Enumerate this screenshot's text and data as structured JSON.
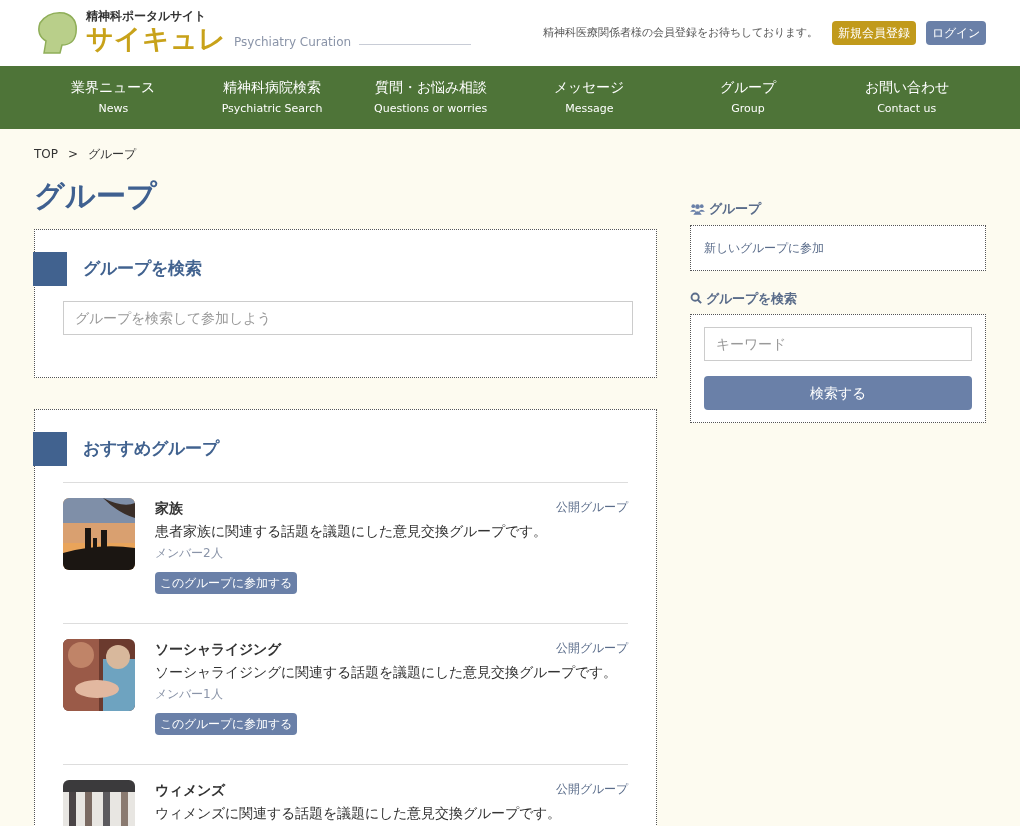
{
  "header": {
    "tagline": "精神科ポータルサイト",
    "logo": "サイキュレ",
    "subtitle": "Psychiatry Curation",
    "notice": "精神科医療関係者様の会員登録をお待ちしております。",
    "buttons": [
      {
        "kind": "register",
        "label": "新規会員登録"
      },
      {
        "kind": "login",
        "label": "ログイン"
      }
    ]
  },
  "nav": [
    {
      "label": "業界ニュース",
      "sub": "News"
    },
    {
      "label": "精神科病院検索",
      "sub": "Psychiatric Search"
    },
    {
      "label": "質問・お悩み相談",
      "sub": "Questions or worries"
    },
    {
      "label": "メッセージ",
      "sub": "Message"
    },
    {
      "label": "グループ",
      "sub": "Group"
    },
    {
      "label": "お問い合わせ",
      "sub": "Contact us"
    }
  ],
  "breadcrumb": [
    "TOP",
    ">",
    "グループ"
  ],
  "page_title": "グループ",
  "search_section": {
    "title": "グループを検索",
    "placeholder": "グループを検索して参加しよう"
  },
  "recommended": {
    "title": "おすすめグループ",
    "groups": [
      {
        "name": "家族",
        "badge": "公開グループ",
        "description": "患者家族に関連する話題を議題にした意見交換グループです。",
        "members": "メンバー2人",
        "join": "このグループに参加する"
      },
      {
        "name": "ソーシャライジング",
        "badge": "公開グループ",
        "description": "ソーシャライジングに関連する話題を議題にした意見交換グループです。",
        "members": "メンバー1人",
        "join": "このグループに参加する"
      },
      {
        "name": "ウィメンズ",
        "badge": "公開グループ",
        "description": "ウィメンズに関連する話題を議題にした意見交換グループです。"
      }
    ]
  },
  "sidebar": {
    "group_title": "グループ",
    "group_link": "新しいグループに参加",
    "search_title": "グループを検索",
    "keyword_placeholder": "キーワード",
    "search_button": "検索する"
  }
}
